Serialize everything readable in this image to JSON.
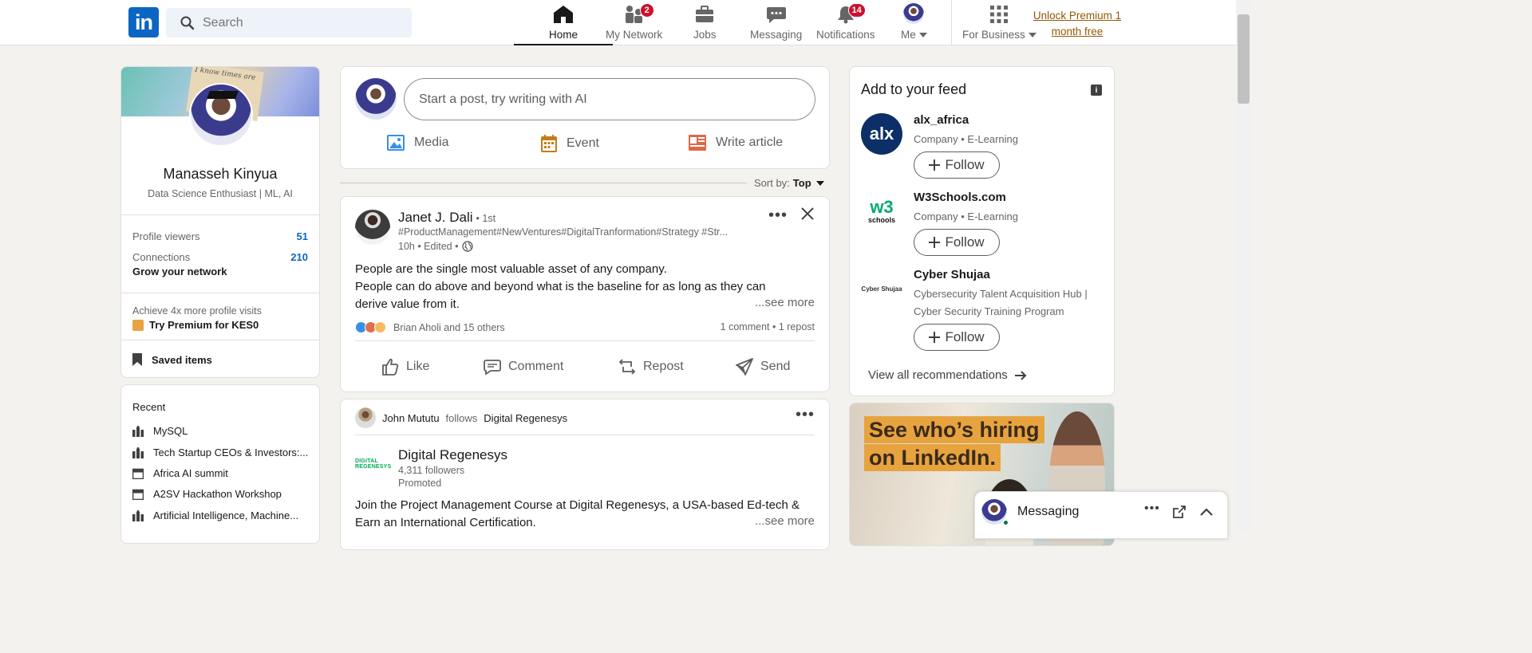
{
  "nav": {
    "logo": "in",
    "search_placeholder": "Search",
    "items": [
      {
        "label": "Home",
        "icon": "home-icon",
        "badge": null
      },
      {
        "label": "My Network",
        "icon": "network-icon",
        "badge": "2"
      },
      {
        "label": "Jobs",
        "icon": "briefcase-icon",
        "badge": null
      },
      {
        "label": "Messaging",
        "icon": "chat-icon",
        "badge": null
      },
      {
        "label": "Notifications",
        "icon": "bell-icon",
        "badge": "14"
      },
      {
        "label": "Me",
        "icon": "avatar",
        "badge": null
      },
      {
        "label": "For Business",
        "icon": "grid-icon",
        "badge": null
      }
    ],
    "premium_line1": "Unlock Premium 1",
    "premium_line2": "month free"
  },
  "profile": {
    "name": "Manasseh Kinyua",
    "headline": "Data Science Enthusiast | ML, AI",
    "cover_text": "I know times are",
    "viewers_label": "Profile viewers",
    "viewers_value": "51",
    "connections_label": "Connections",
    "connections_value": "210",
    "grow_label": "Grow your network",
    "premium_prompt": "Achieve 4x more profile visits",
    "premium_cta": "Try Premium for KES0",
    "saved_label": "Saved items"
  },
  "recent": {
    "title": "Recent",
    "items": [
      {
        "label": "MySQL",
        "icon": "group-icon"
      },
      {
        "label": "Tech Startup CEOs & Investors:...",
        "icon": "group-icon"
      },
      {
        "label": "Africa AI summit",
        "icon": "event-icon"
      },
      {
        "label": "A2SV Hackathon Workshop",
        "icon": "event-icon"
      },
      {
        "label": "Artificial Intelligence, Machine...",
        "icon": "group-icon"
      }
    ]
  },
  "composer": {
    "placeholder": "Start a post, try writing with AI",
    "actions": [
      "Media",
      "Event",
      "Write article"
    ]
  },
  "sort": {
    "label": "Sort by:",
    "value": "Top"
  },
  "post": {
    "author": "Janet J. Dali",
    "degree": "• 1st",
    "tags": "#ProductManagement#NewVentures#DigitalTranformation#Strategy #Str...",
    "time": "10h • Edited •",
    "body_line1": "People are the single most valuable asset of any company.",
    "body_line2": "People can do above and beyond what is the baseline for as long as they can derive value from it.",
    "see_more": "...see more",
    "reactions": "Brian Aholi and 15 others",
    "meta": "1 comment • 1 repost",
    "actions": [
      "Like",
      "Comment",
      "Repost",
      "Send"
    ]
  },
  "promo": {
    "actor": "John Mututu",
    "verb": "follows",
    "target": "Digital Regenesys",
    "name": "Digital Regenesys",
    "followers": "4,311 followers",
    "promoted": "Promoted",
    "body": "Join the Project Management Course at Digital Regenesys, a USA-based Ed-tech & Earn an International Certification.",
    "see_more": "...see more",
    "logo_text": "DIGITAL REGENESYS"
  },
  "feed": {
    "title": "Add to your feed",
    "info": "i",
    "recs": [
      {
        "name": "alx_africa",
        "desc": "Company • E-Learning",
        "follow": "Follow",
        "logo_text": "alx"
      },
      {
        "name": "W3Schools.com",
        "desc": "Company • E-Learning",
        "follow": "Follow",
        "logo_text": "w3",
        "logo_sub": "schools"
      },
      {
        "name": "Cyber Shujaa",
        "desc": "Cybersecurity Talent Acquisition Hub | Cyber Security Training Program",
        "follow": "Follow",
        "logo_text": "Cyber Shujaa"
      }
    ],
    "view_all": "View all recommendations"
  },
  "ad": {
    "line1": "See who’s hiring",
    "line2": "on LinkedIn."
  },
  "messaging": {
    "label": "Messaging"
  },
  "colors": {
    "brand": "#0a66c2",
    "badge": "#cb112d",
    "premium": "#915907",
    "online": "#057642"
  }
}
